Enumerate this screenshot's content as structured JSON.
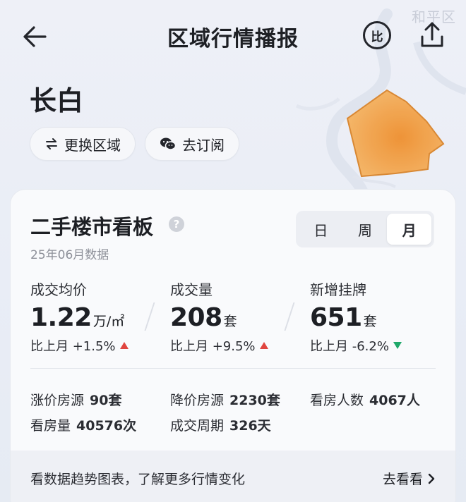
{
  "watermark": "和平区",
  "header": {
    "title": "区域行情播报",
    "compare_label": "比"
  },
  "district": {
    "name": "长白"
  },
  "actions": {
    "switch_label": "更换区域",
    "subscribe_label": "去订阅"
  },
  "dashboard": {
    "title": "二手楼市看板",
    "help": "?",
    "date": "25年06月数据",
    "period_tabs": [
      {
        "label": "日",
        "active": false
      },
      {
        "label": "周",
        "active": false
      },
      {
        "label": "月",
        "active": true
      }
    ],
    "metrics": [
      {
        "label": "成交均价",
        "value": "1.22",
        "unit": "万/㎡",
        "change": "比上月 +1.5%",
        "trend": "up"
      },
      {
        "label": "成交量",
        "value": "208",
        "unit": "套",
        "change": "比上月 +9.5%",
        "trend": "up"
      },
      {
        "label": "新增挂牌",
        "value": "651",
        "unit": "套",
        "change": "比上月 -6.2%",
        "trend": "down"
      }
    ],
    "stats": [
      {
        "label": "涨价房源",
        "value": "90套"
      },
      {
        "label": "降价房源",
        "value": "2230套"
      },
      {
        "label": "看房人数",
        "value": "4067人"
      },
      {
        "label": "看房量",
        "value": "40576次"
      },
      {
        "label": "成交周期",
        "value": "326天"
      }
    ],
    "footer_text": "看数据趋势图表，了解更多行情变化",
    "footer_link": "去看看"
  },
  "colors": {
    "up": "#e0453f",
    "down": "#1fa86a",
    "region_fill": "#f0a44c"
  }
}
